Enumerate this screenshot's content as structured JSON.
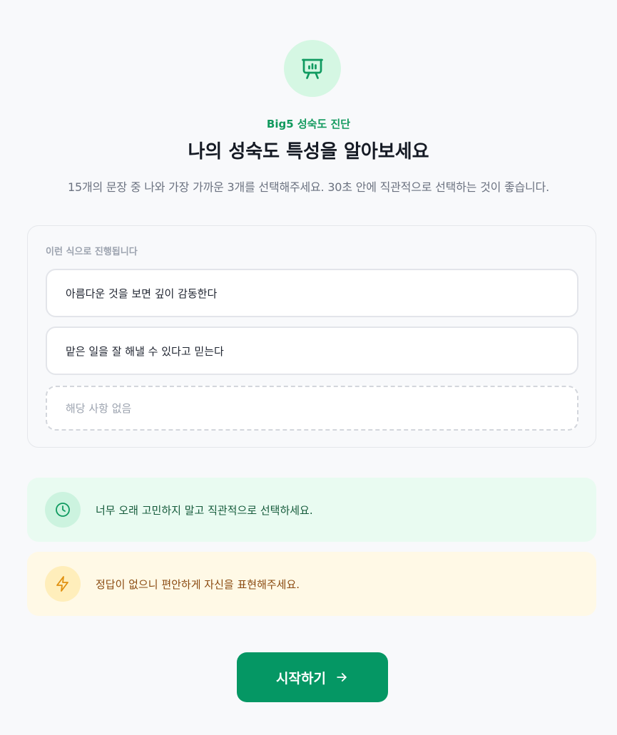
{
  "header": {
    "icon": "presentation-chart-icon",
    "eyebrow": "Big5 성숙도 진단",
    "title": "나의 성숙도 특성을 알아보세요",
    "subtitle": "15개의 문장 중 나와 가장 가까운 3개를 선택해주세요. 30초 안에 직관적으로 선택하는 것이 좋습니다."
  },
  "example": {
    "label": "이런 식으로 진행됩니다",
    "options": [
      "아름다운 것을 보면 깊이 감동한다",
      "맡은 일을 잘 해낼 수 있다고 믿는다"
    ],
    "none_option": "해당 사항 없음"
  },
  "tips": [
    {
      "icon": "clock-icon",
      "text": "너무 오래 고민하지 말고 직관적으로 선택하세요.",
      "color": "#0f9a60"
    },
    {
      "icon": "lightning-icon",
      "text": "정답이 없으니 편안하게 자신을 표현해주세요.",
      "color": "#e0900f"
    }
  ],
  "start_button": {
    "label": "시작하기",
    "icon": "arrow-right-icon"
  },
  "colors": {
    "accent": "#059764",
    "background": "#f8f9fb"
  }
}
